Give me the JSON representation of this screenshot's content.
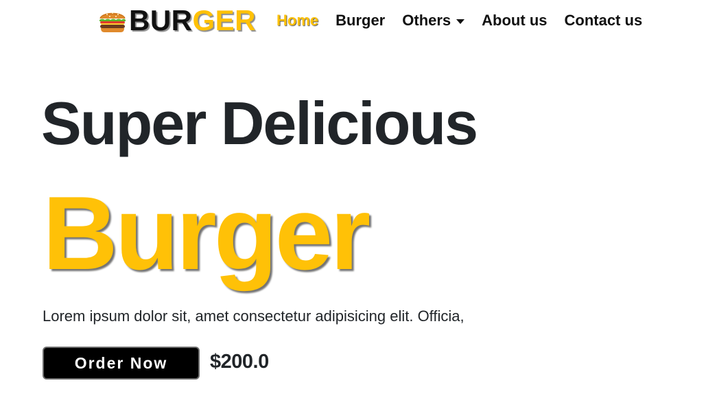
{
  "navbar": {
    "brand": {
      "icon": "burger-icon",
      "part1": "BUR",
      "part2": "GER"
    },
    "links": [
      {
        "label": "Home",
        "active": true
      },
      {
        "label": "Burger",
        "active": false
      },
      {
        "label": "Others",
        "active": false,
        "dropdown": true,
        "icon": "caret-down-icon"
      },
      {
        "label": "About us",
        "active": false
      },
      {
        "label": "Contact us",
        "active": false
      }
    ]
  },
  "hero": {
    "title": "Super Delicious",
    "highlight": "Burger",
    "description": "Lorem ipsum dolor sit, amet consectetur adipisicing elit. Officia,",
    "order_button": "Order Now",
    "price": "$200.0"
  },
  "colors": {
    "accent": "#ffc107",
    "text": "#212529",
    "button_bg": "#000000",
    "button_text": "#ffffff"
  }
}
